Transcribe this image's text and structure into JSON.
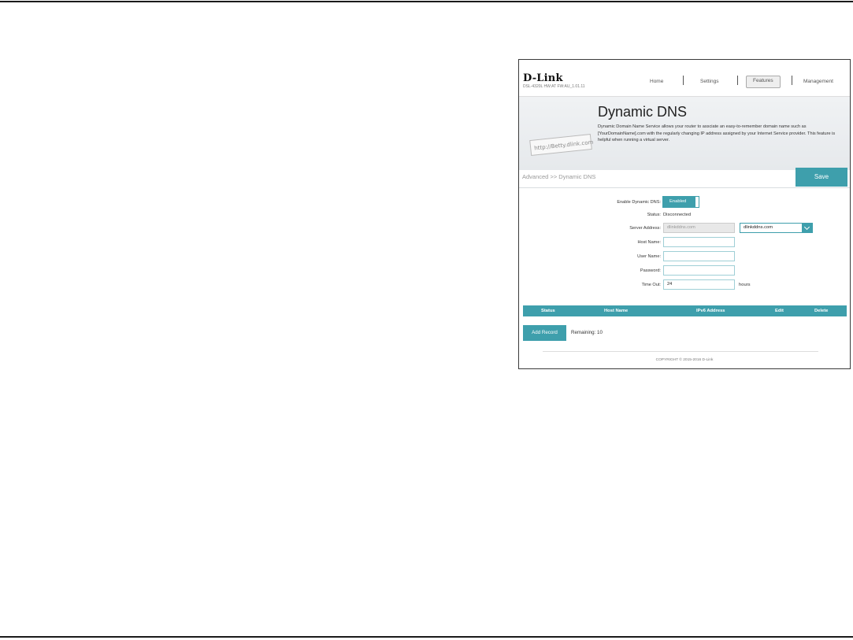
{
  "header": {
    "logo": "D-Link",
    "model": "DSL-4320L  HW:AT  FW:AU_1.01.11",
    "nav": [
      "Home",
      "Settings",
      "Features",
      "Management"
    ]
  },
  "banner": {
    "card_text": "http://Betty.dlink.com",
    "title": "Dynamic DNS",
    "description": "Dynamic Domain Name Service allows your router to assciate an easy-to-remember domain name such as [YourDomainName].com with the regularly changing IP address assigned by your Internet Service provider. This feature is helpful when running a virtual server."
  },
  "breadcrumb": "Advanced >> Dynamic DNS",
  "save_label": "Save",
  "form": {
    "enable_label": "Enable Dynamic DNS:",
    "enable_value": "Enabled",
    "status_label": "Status:",
    "status_value": "Disconnected",
    "server_label": "Server Address:",
    "server_value": "dlinkddns.com",
    "server_select": "dlinkddns.com",
    "host_label": "Host Name:",
    "host_value": "",
    "user_label": "User Name:",
    "user_value": "",
    "password_label": "Password:",
    "password_value": "",
    "timeout_label": "Time Out:",
    "timeout_value": "24",
    "timeout_unit": "hours"
  },
  "table": {
    "columns": [
      "Status",
      "Host Name",
      "IPv6 Address",
      "Edit",
      "Delete"
    ]
  },
  "add_record_label": "Add Record",
  "remaining_text": "Remaining: 10",
  "copyright": "COPYRIGHT © 2015-2016 D-Link",
  "colors": {
    "accent": "#3e9fac"
  }
}
